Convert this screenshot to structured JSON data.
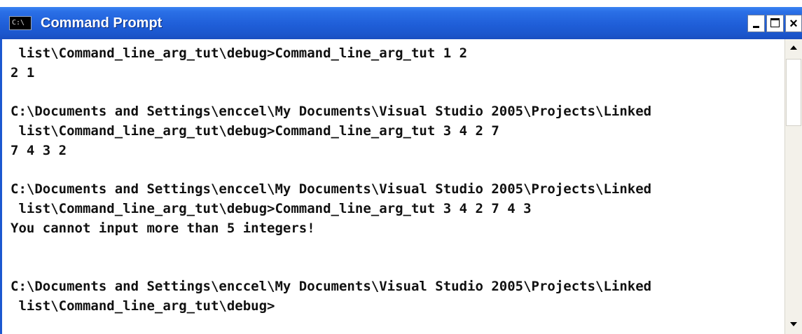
{
  "window": {
    "title": "Command Prompt",
    "icon_text": "C:\\",
    "title_icon": "cmd-window-icon",
    "buttons": {
      "minimize": "minimize-icon",
      "maximize": "maximize-icon",
      "close": "close-icon"
    },
    "colors": {
      "titlebar": "#1f5ed8",
      "console_background": "#ffffff",
      "console_text": "#111111"
    }
  },
  "console": {
    "lines": [
      " list\\Command_line_arg_tut\\debug>Command_line_arg_tut 1 2",
      "2 1",
      "",
      "C:\\Documents and Settings\\enccel\\My Documents\\Visual Studio 2005\\Projects\\Linked",
      " list\\Command_line_arg_tut\\debug>Command_line_arg_tut 3 4 2 7",
      "7 4 3 2",
      "",
      "C:\\Documents and Settings\\enccel\\My Documents\\Visual Studio 2005\\Projects\\Linked",
      " list\\Command_line_arg_tut\\debug>Command_line_arg_tut 3 4 2 7 4 3",
      "You cannot input more than 5 integers!",
      "",
      "",
      "C:\\Documents and Settings\\enccel\\My Documents\\Visual Studio 2005\\Projects\\Linked",
      " list\\Command_line_arg_tut\\debug>"
    ]
  },
  "scrollbar": {
    "up_icon": "scroll-up-arrow-icon",
    "down_icon": "scroll-down-arrow-icon"
  }
}
